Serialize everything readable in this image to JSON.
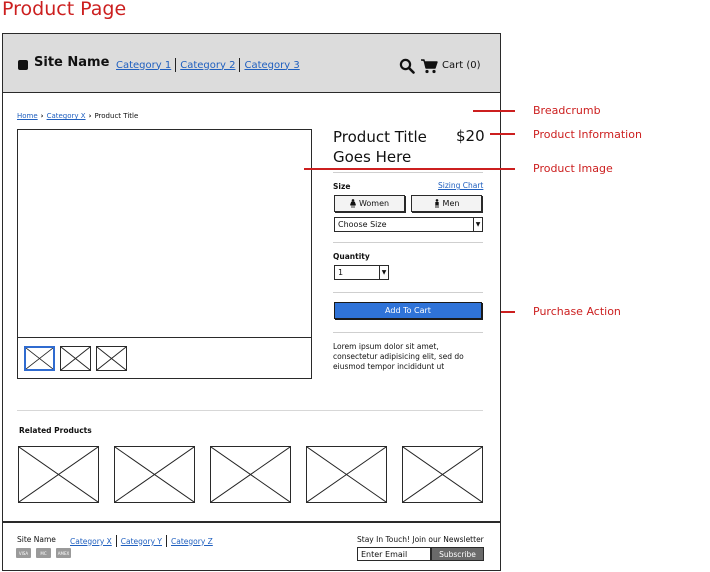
{
  "page_heading": "Product Page",
  "header": {
    "site_name": "Site Name",
    "nav": [
      "Category 1",
      "Category 2",
      "Category 3"
    ],
    "cart_label": "Cart (0)"
  },
  "breadcrumb": {
    "items": [
      "Home",
      "Category X",
      "Product Title"
    ]
  },
  "product": {
    "title": "Product Title Goes Here",
    "price": "$20",
    "size_label": "Size",
    "sizing_chart": "Sizing Chart",
    "size_buttons": [
      "Women",
      "Men"
    ],
    "size_select": "Choose Size",
    "quantity_label": "Quantity",
    "quantity_value": "1",
    "add_to_cart": "Add To Cart",
    "description": "Lorem ipsum dolor sit amet, consectetur adipisicing elit, sed do eiusmod tempor incididunt ut"
  },
  "related": {
    "title": "Related Products"
  },
  "footer": {
    "site_name": "Site Name",
    "nav": [
      "Category X",
      "Category Y",
      "Category Z"
    ],
    "payment_icons": [
      "VISA",
      "MC",
      "AMEX"
    ],
    "newsletter_label": "Stay In Touch! Join our Newsletter",
    "email_placeholder": "Enter Email",
    "subscribe": "Subscribe"
  },
  "annotations": {
    "breadcrumb": "Breadcrumb",
    "product_information": "Product Information",
    "product_image": "Product Image",
    "purchase_action": "Purchase Action"
  },
  "colors": {
    "annotation": "#cc1f1f",
    "link": "#1f5fbf",
    "primary_button": "#2f73d8",
    "header_bg": "#dcdcdc"
  }
}
